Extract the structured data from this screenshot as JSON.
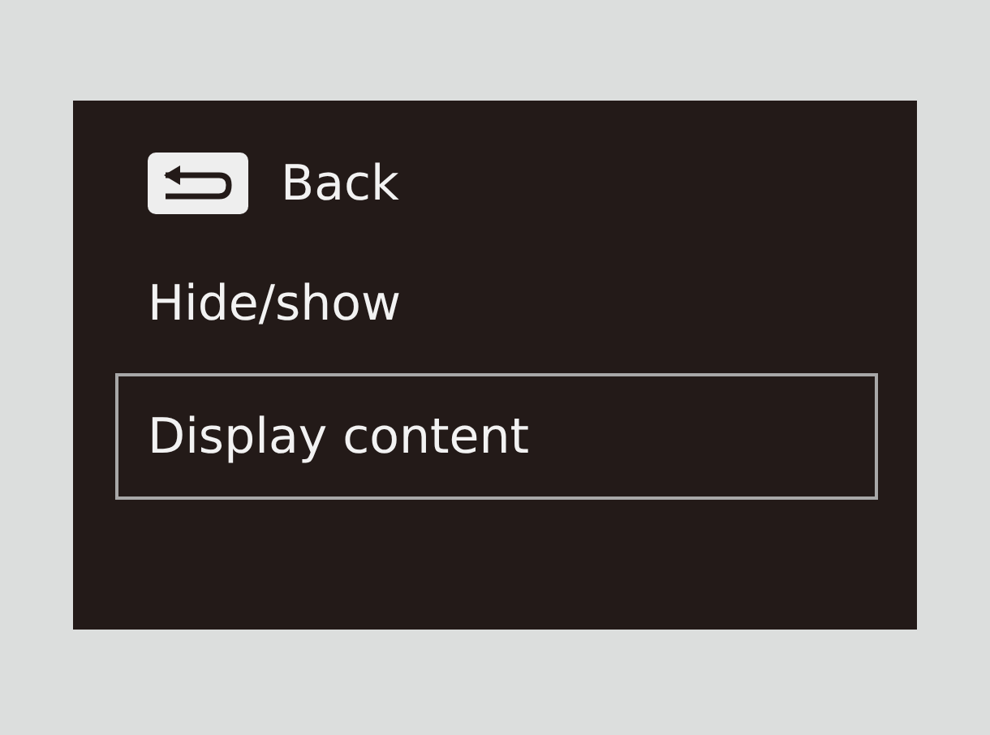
{
  "menu": {
    "items": [
      {
        "kind": "back",
        "label": "Back",
        "selected": false
      },
      {
        "kind": "item",
        "label": "Hide/show",
        "selected": false
      },
      {
        "kind": "item",
        "label": "Display content",
        "selected": true
      }
    ]
  }
}
